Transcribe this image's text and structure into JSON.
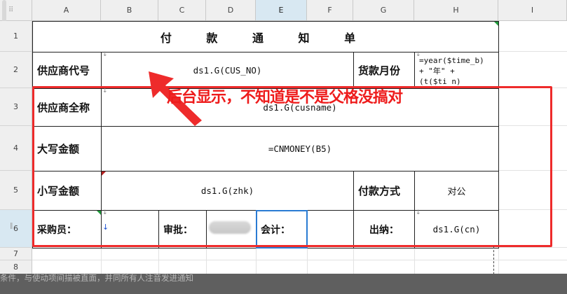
{
  "spreadsheet": {
    "columns": [
      "A",
      "B",
      "C",
      "D",
      "E",
      "F",
      "G",
      "H",
      "I"
    ],
    "active_column": "E",
    "rows": [
      "1",
      "2",
      "3",
      "4",
      "5",
      "6",
      "7",
      "8"
    ],
    "active_row": "6",
    "corner_glyph": "⠿"
  },
  "form": {
    "title": "付 款 通 知 单",
    "supplier_code_label": "供应商代号",
    "supplier_code_value": "ds1.G(CUS_NO)",
    "payment_month_label": "货款月份",
    "payment_month_formula": "=year($time_b)\n+ \"年\" +\n(t($ti n)",
    "supplier_name_label": "供应商全称",
    "supplier_name_value": "ds1.G(cusname)",
    "amount_words_label": "大写金额",
    "amount_words_value": "=CNMONEY(B5)",
    "amount_figures_label": "小写金额",
    "amount_figures_value": "ds1.G(zhk)",
    "payment_method_label": "付款方式",
    "payment_method_value": "对公",
    "buyer_label": "采购员：",
    "approval_label": "审批：",
    "accountant_label": "会计：",
    "cashier_label": "出纳：",
    "cashier_value": "ds1.G(cn)"
  },
  "annotation": {
    "text": "后台显示，不知道是不是父格没搞对",
    "color": "#ee1c1c"
  },
  "status_bar": {
    "text": "条件，与使动项间描被直面，并同所有人注音发进通知"
  }
}
